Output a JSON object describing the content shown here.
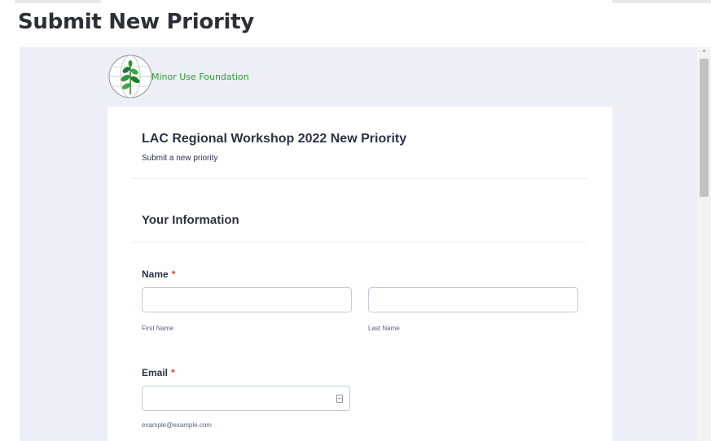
{
  "page": {
    "title": "Submit New Priority"
  },
  "logo": {
    "text": "Minor Use Foundation"
  },
  "form": {
    "title": "LAC Regional Workshop 2022 New Priority",
    "subtitle": "Submit a new priority",
    "section_title": "Your Information",
    "name": {
      "label": "Name",
      "required_mark": "*",
      "first_value": "",
      "last_value": "",
      "first_sublabel": "First Name",
      "last_sublabel": "Last Name"
    },
    "email": {
      "label": "Email",
      "required_mark": "*",
      "value": "",
      "sublabel": "example@example.com"
    }
  },
  "colors": {
    "accent_green": "#2e9b3a",
    "required_red": "#f23a3c",
    "frame_bg": "#eeeff6"
  }
}
